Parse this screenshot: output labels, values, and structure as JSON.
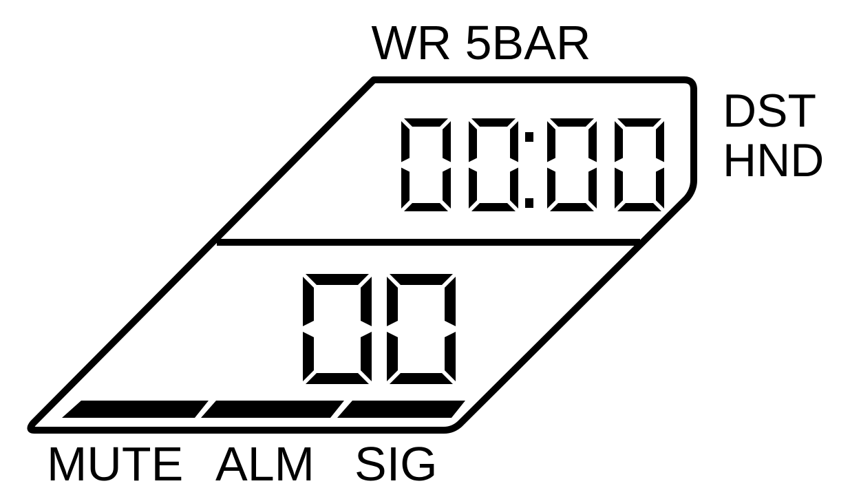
{
  "labels": {
    "water_resistance": "WR 5BAR",
    "dst": "DST",
    "hnd": "HND",
    "mute": "MUTE",
    "alm": "ALM",
    "sig": "SIG"
  },
  "time_display": {
    "digits": [
      "0",
      "0",
      "0",
      "0"
    ],
    "separator": ":"
  },
  "seconds_display": {
    "digits": [
      "0",
      "0"
    ]
  },
  "indicator_bars": [
    "mute-bar",
    "alarm-bar",
    "signal-bar"
  ],
  "colors": {
    "ink": "#000000",
    "background": "#ffffff"
  }
}
